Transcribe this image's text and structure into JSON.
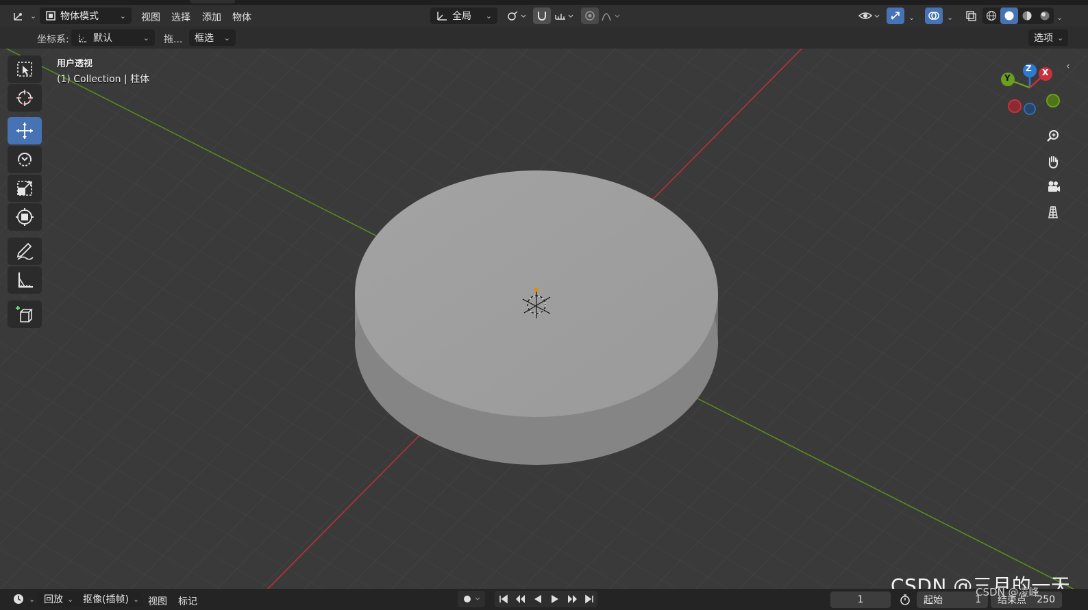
{
  "header": {
    "editor_icon": "transform-gizmo-icon",
    "mode_label": "物体模式",
    "menus": [
      "视图",
      "选择",
      "添加",
      "物体"
    ],
    "orientation_label": "全局",
    "options_label": "选项"
  },
  "tool_settings": {
    "coord_label": "坐标系:",
    "coord_value": "默认",
    "drag_label": "拖...",
    "select_mode": "框选"
  },
  "viewport": {
    "view_name": "用户透视",
    "collection_info": "(1) Collection | 柱体",
    "gizmo_axes": [
      "Z",
      "Y",
      "X"
    ]
  },
  "toolbar": {
    "tools": [
      "select-box",
      "cursor",
      "move",
      "rotate",
      "scale",
      "transform",
      "annotate",
      "measure",
      "add-cube"
    ],
    "active_tool": "move"
  },
  "timeline": {
    "playback_label": "回放",
    "keying_label": "抠像(插帧)",
    "view_label": "视图",
    "marker_label": "标记",
    "current_frame": "1",
    "start_label": "起始",
    "start_value": "1",
    "end_label": "结束点",
    "end_value": "250"
  },
  "watermark": {
    "main": "CSDN @三月的一天",
    "sub": "CSDN @凌峰"
  },
  "colors": {
    "accent": "#4772b3",
    "x_axis": "#c8323c",
    "y_axis": "#6b9e1f",
    "z_axis": "#2e78d6"
  }
}
